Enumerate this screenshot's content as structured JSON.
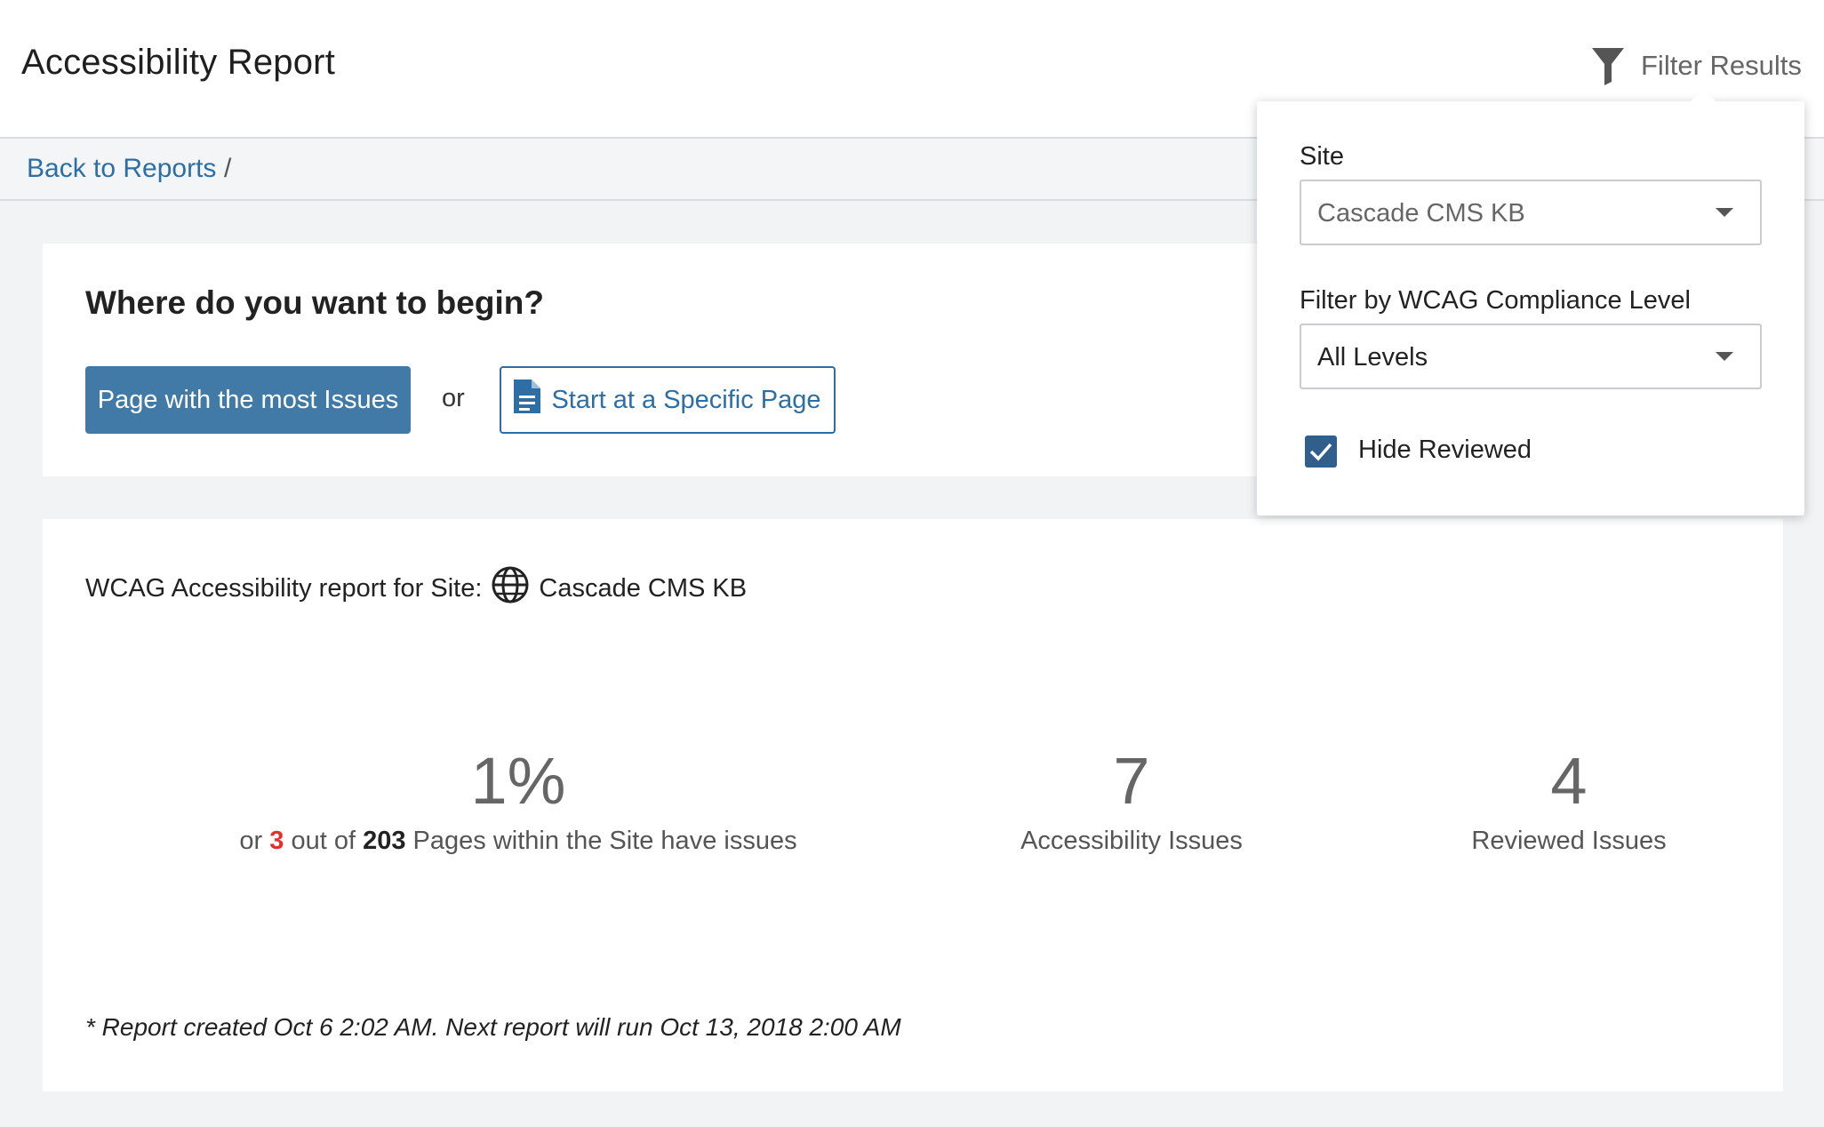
{
  "header": {
    "title": "Accessibility Report",
    "filter_label": "Filter Results"
  },
  "breadcrumb": {
    "back_label": "Back to Reports",
    "separator": "/"
  },
  "begin": {
    "heading": "Where do you want to begin?",
    "most_issues_button": "Page with the most Issues",
    "or_text": "or",
    "specific_page_button": "Start at a Specific Page"
  },
  "report": {
    "prefix": "WCAG Accessibility report for Site:",
    "site_name": "Cascade CMS KB",
    "stats": {
      "percent": "1%",
      "pages_or": "or",
      "pages_with_issues": "3",
      "pages_out_of": "out of",
      "total_pages": "203",
      "pages_suffix": "Pages within the Site have issues",
      "accessibility_issues_count": "7",
      "accessibility_issues_label": "Accessibility Issues",
      "reviewed_issues_count": "4",
      "reviewed_issues_label": "Reviewed Issues"
    },
    "note": "* Report created Oct 6 2:02 AM. Next report will run Oct 13, 2018 2:00 AM"
  },
  "filter_panel": {
    "site_label": "Site",
    "site_value": "Cascade CMS KB",
    "level_label": "Filter by WCAG Compliance Level",
    "level_value": "All Levels",
    "hide_reviewed_label": "Hide Reviewed",
    "hide_reviewed_checked": true
  },
  "colors": {
    "primary": "#427aa7",
    "link": "#2d6ea4",
    "highlight": "#e0312d",
    "checkbox": "#2f5f8a"
  }
}
